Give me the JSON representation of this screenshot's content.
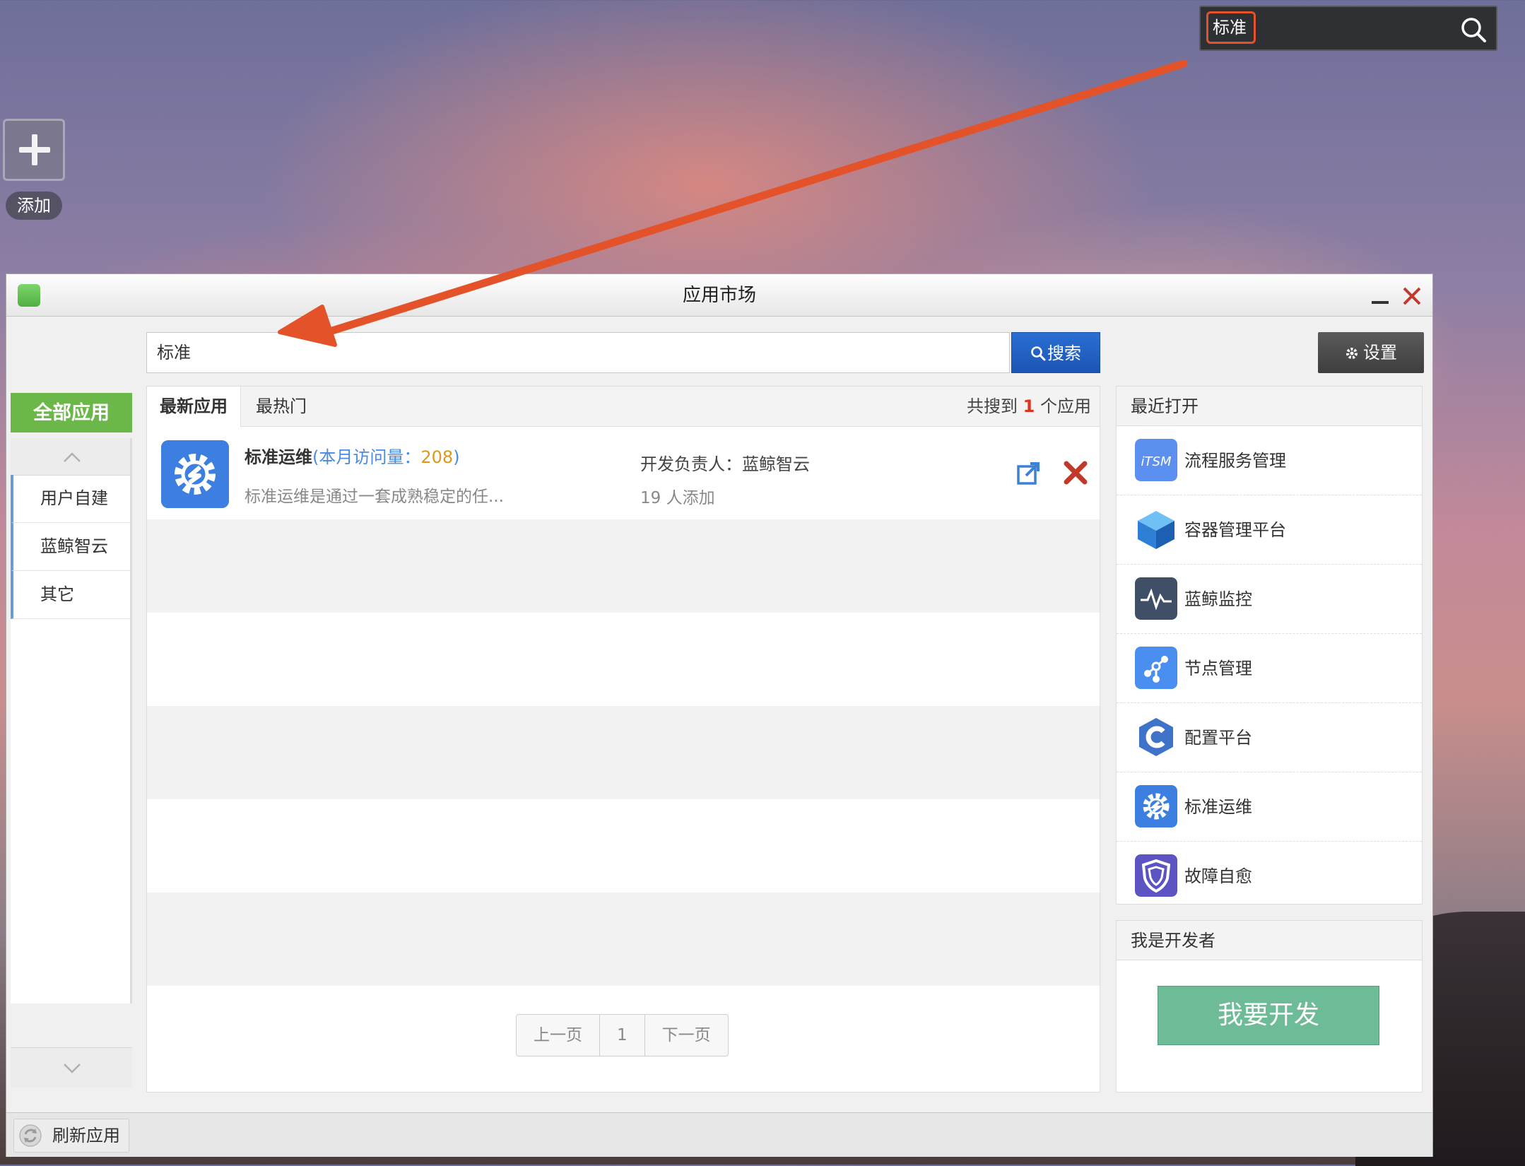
{
  "desktop": {
    "search_value": "标准",
    "add_label": "添加"
  },
  "window": {
    "title": "应用市场",
    "search_value": "标准",
    "search_button": "搜索",
    "settings_button": "设置"
  },
  "sidebar": {
    "all_apps": "全部应用",
    "items": [
      {
        "label": "用户自建"
      },
      {
        "label": "蓝鲸智云"
      },
      {
        "label": "其它"
      }
    ]
  },
  "main": {
    "tabs": [
      {
        "label": "最新应用"
      },
      {
        "label": "最热门"
      }
    ],
    "count_prefix": "共搜到",
    "count_value": "1",
    "count_suffix": "个应用",
    "apps": [
      {
        "name": "标准运维",
        "visits_label": "(本月访问量：",
        "visits_value": "208",
        "visits_close": ")",
        "description": "标准运维是通过一套成熟稳定的任...",
        "developer": "开发负责人：蓝鲸智云",
        "added": "19 人添加"
      }
    ],
    "pagination": {
      "prev": "上一页",
      "current": "1",
      "next": "下一页"
    }
  },
  "recent": {
    "title": "最近打开",
    "items": [
      {
        "label": "流程服务管理",
        "icon": "itsm-icon",
        "color": "#5b8ff0"
      },
      {
        "label": "容器管理平台",
        "icon": "container-cube-icon",
        "color": "#3a8ee6"
      },
      {
        "label": "蓝鲸监控",
        "icon": "monitor-pulse-icon",
        "color": "#3e4f66"
      },
      {
        "label": "节点管理",
        "icon": "node-graph-icon",
        "color": "#4a8ef0"
      },
      {
        "label": "配置平台",
        "icon": "config-c-icon",
        "color": "#3f73c9"
      },
      {
        "label": "标准运维",
        "icon": "gear-s-icon",
        "color": "#3c7fe0"
      },
      {
        "label": "故障自愈",
        "icon": "shield-icon",
        "color": "#5c54c2"
      }
    ]
  },
  "developer": {
    "title": "我是开发者",
    "button": "我要开发"
  },
  "statusbar": {
    "refresh": "刷新应用"
  },
  "colors": {
    "accent_green": "#6cb74a",
    "search_blue": "#1b55b4",
    "arrow_orange": "#e4522a",
    "dev_button": "#6dbb97"
  }
}
